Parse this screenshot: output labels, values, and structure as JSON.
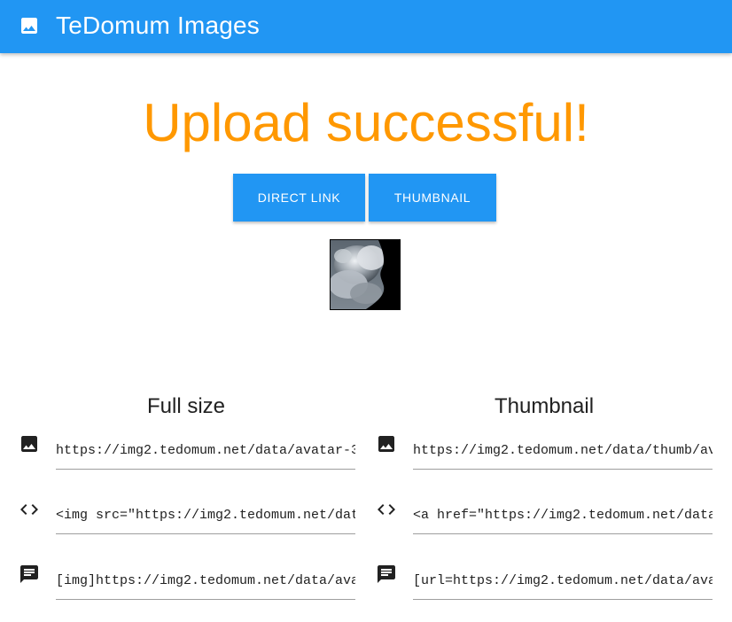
{
  "app": {
    "title": "TeDomum Images",
    "logo_icon": "image-icon",
    "bar_color": "#2196f3"
  },
  "headline": {
    "text": "Upload successful!",
    "color": "#ff9800"
  },
  "buttons": {
    "direct_link": "Direct link",
    "thumbnail": "Thumbnail"
  },
  "preview": {
    "alt": "uploaded image thumbnail"
  },
  "full_size": {
    "title": "Full size",
    "rows": [
      {
        "icon": "image-icon",
        "value": "https://img2.tedomum.net/data/avatar-3"
      },
      {
        "icon": "code-icon",
        "value": "<img src=\"https://img2.tedomum.net/dat"
      },
      {
        "icon": "comment-icon",
        "value": "[img]https://img2.tedomum.net/data/ava"
      }
    ]
  },
  "thumbnail": {
    "title": "Thumbnail",
    "rows": [
      {
        "icon": "image-icon",
        "value": "https://img2.tedomum.net/data/thumb/av"
      },
      {
        "icon": "code-icon",
        "value": "<a href=\"https://img2.tedomum.net/data"
      },
      {
        "icon": "comment-icon",
        "value": "[url=https://img2.tedomum.net/data/ava"
      }
    ]
  }
}
